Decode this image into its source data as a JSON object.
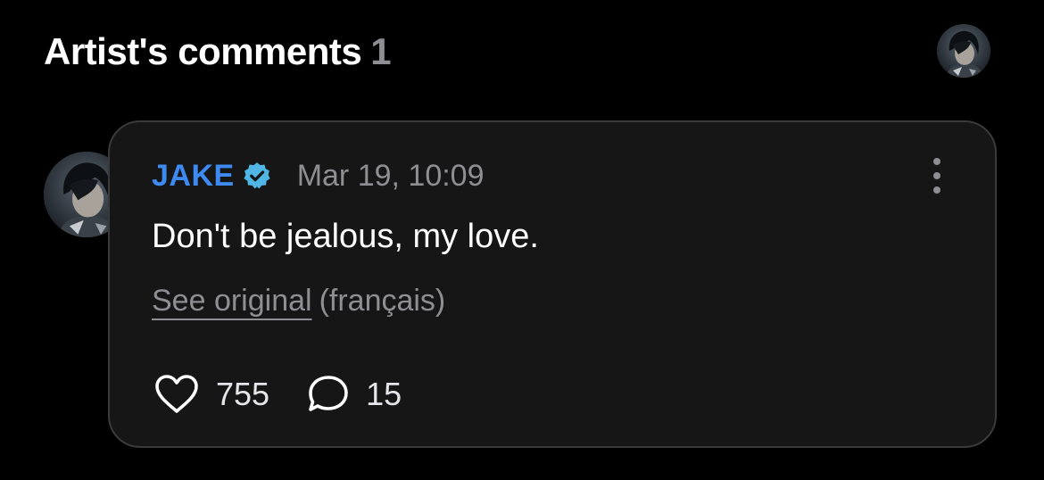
{
  "header": {
    "title": "Artist's comments",
    "count": "1"
  },
  "comment": {
    "author": "JAKE",
    "verified": true,
    "timestamp": "Mar 19, 10:09",
    "text": "Don't be jealous, my love.",
    "see_original_label": "See original",
    "original_language": "(français)",
    "likes": "755",
    "replies": "15"
  },
  "icons": {
    "verified": "verified-badge-icon",
    "more": "more-vertical-icon",
    "like": "heart-outline-icon",
    "reply": "speech-bubble-icon"
  },
  "colors": {
    "background": "#000000",
    "card": "#161616",
    "card_border": "#3a3a3c",
    "author_name": "#3d8bf2",
    "verified_badge": "#4fb6e6",
    "muted_text": "#8e8e93"
  }
}
